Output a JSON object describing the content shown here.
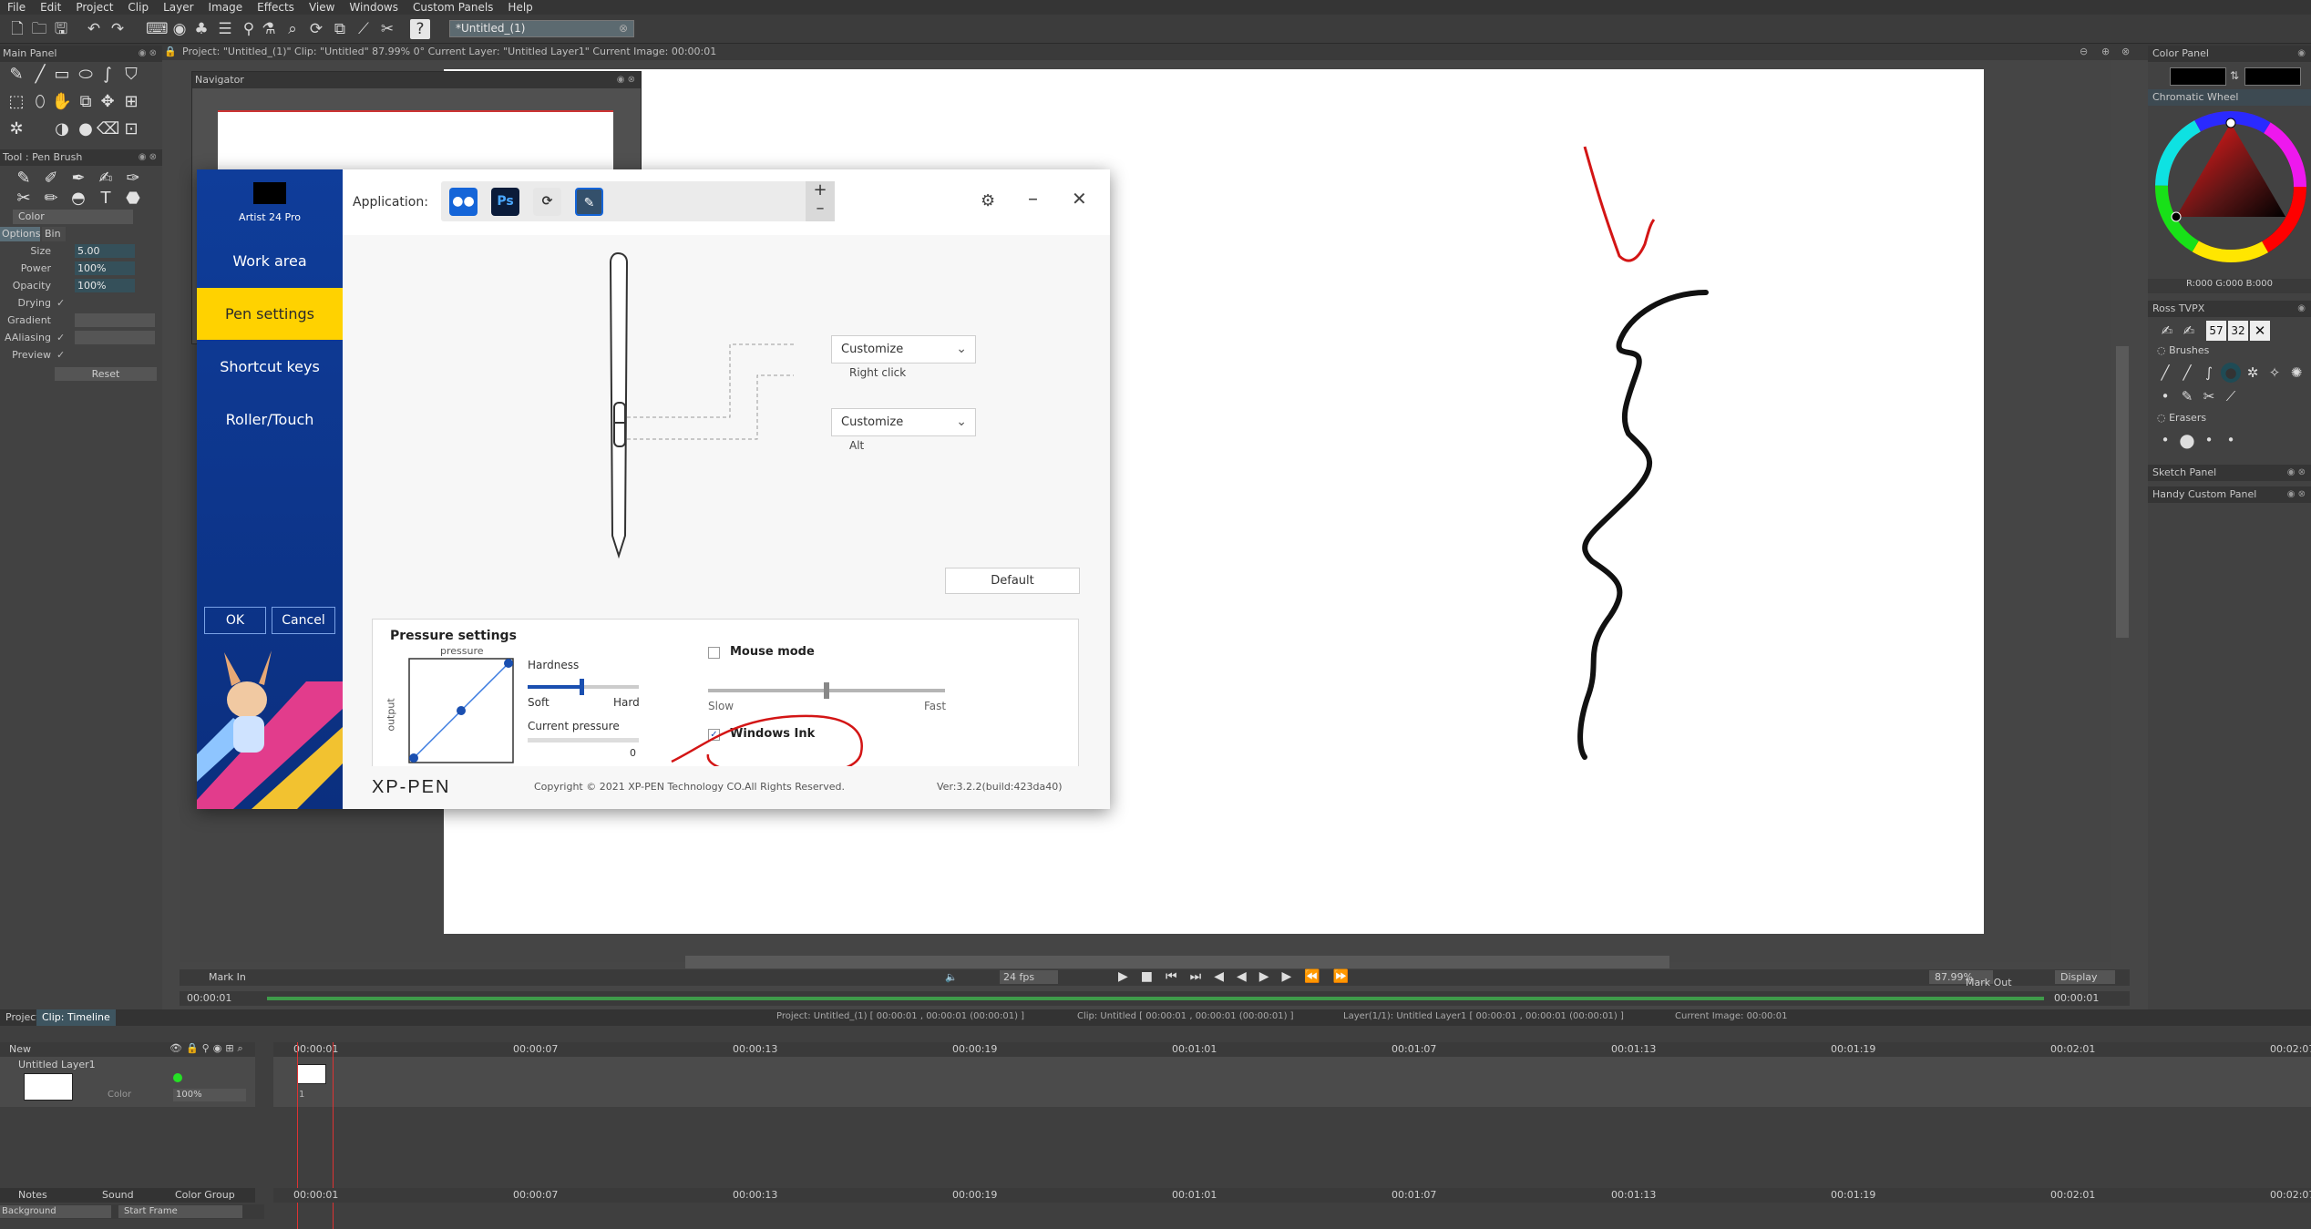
{
  "menu": [
    "File",
    "Edit",
    "Project",
    "Clip",
    "Layer",
    "Image",
    "Effects",
    "View",
    "Windows",
    "Custom Panels",
    "Help"
  ],
  "toolbar": {
    "doc_tab": "*Untitled_(1)"
  },
  "status_line": "Project: \"Untitled_(1)\"  Clip: \"Untitled\"  87.99%  0°  Current Layer: \"Untitled Layer1\"  Current Image: 00:00:01",
  "left_panel": {
    "main_panel_title": "Main Panel",
    "tool_title": "Tool : Pen Brush",
    "color_label": "Color",
    "tabs": [
      "Options",
      "Bin"
    ],
    "props": [
      {
        "label": "Size",
        "value": "5.00"
      },
      {
        "label": "Power",
        "value": "100%"
      },
      {
        "label": "Opacity",
        "value": "100%"
      }
    ],
    "checks": [
      "Drying",
      "Gradient",
      "AAliasing",
      "Preview"
    ],
    "reset_label": "Reset"
  },
  "navigator": {
    "title": "Navigator"
  },
  "dialog": {
    "device": "Artist 24 Pro",
    "nav": [
      "Work area",
      "Pen settings",
      "Shortcut keys",
      "Roller/Touch"
    ],
    "active_nav": "Pen settings",
    "ok": "OK",
    "cancel": "Cancel",
    "application_label": "Application:",
    "app_icons": [
      {
        "name": "all-apps",
        "text": "●●"
      },
      {
        "name": "photoshop",
        "text": "Ps"
      },
      {
        "name": "lasso",
        "text": "⟳"
      },
      {
        "name": "tvpaint",
        "text": "✎"
      }
    ],
    "plus": "+",
    "minus": "–",
    "button1": {
      "value": "Customize",
      "caption": "Right click"
    },
    "button2": {
      "value": "Customize",
      "caption": "Alt"
    },
    "default_label": "Default",
    "pressure": {
      "title": "Pressure settings",
      "graph_top": "pressure",
      "graph_side": "output",
      "hardness_label": "Hardness",
      "soft": "Soft",
      "hard": "Hard",
      "current_pressure_label": "Current pressure",
      "current_pressure_value": "0",
      "hardness_level": 0.48,
      "mouse_mode_label": "Mouse mode",
      "mouse_mode_checked": false,
      "slow": "Slow",
      "fast": "Fast",
      "speed_level": 0.5,
      "windows_ink_label": "Windows Ink",
      "windows_ink_checked": true
    },
    "brand": "XP-PEN",
    "copyright": "Copyright © 2021 XP-PEN Technology CO.All Rights Reserved.",
    "version": "Ver:3.2.2(build:423da40)"
  },
  "canvas_bar": {
    "mark_in": "Mark In",
    "mark_in_time": "00:00:01",
    "fps": "24 fps",
    "zoom": "87.99%",
    "display": "Display",
    "mark_out": "Mark Out",
    "mark_out_time": "00:00:01"
  },
  "right_panel": {
    "color_panel": "Color Panel",
    "chromatic_wheel": "Chromatic Wheel",
    "rgb_readout": "R:000 G:000 B:000",
    "ross_title": "Ross TVPX",
    "brushes_label": "Brushes",
    "erasers_label": "Erasers",
    "brush_sizes": [
      "57",
      "32"
    ],
    "sketch_panel": "Sketch Panel",
    "handy_panel": "Handy Custom Panel"
  },
  "timeline": {
    "tabs": [
      "Project",
      "Clip: Timeline"
    ],
    "info": [
      "Project: Untitled_(1) [ 00:00:01 , 00:00:01  (00:00:01) ]",
      "Clip: Untitled [ 00:00:01 , 00:00:01  (00:00:01) ]",
      "Layer(1/1): Untitled Layer1 [ 00:00:01 , 00:00:01  (00:00:01) ]",
      "Current Image: 00:00:01"
    ],
    "new_label": "New",
    "layer_name": "Untitled Layer1",
    "layer_color": "Color",
    "layer_opacity": "100%",
    "ticks": [
      "00:00:01",
      "00:00:07",
      "00:00:13",
      "00:00:19",
      "00:01:01",
      "00:01:07",
      "00:01:13",
      "00:01:19",
      "00:02:01",
      "00:02:07"
    ],
    "frame_number": "1",
    "bottom_tabs": [
      "Notes",
      "Sound",
      "Color Group"
    ],
    "background_label": "Background",
    "start_frame_label": "Start Frame"
  }
}
